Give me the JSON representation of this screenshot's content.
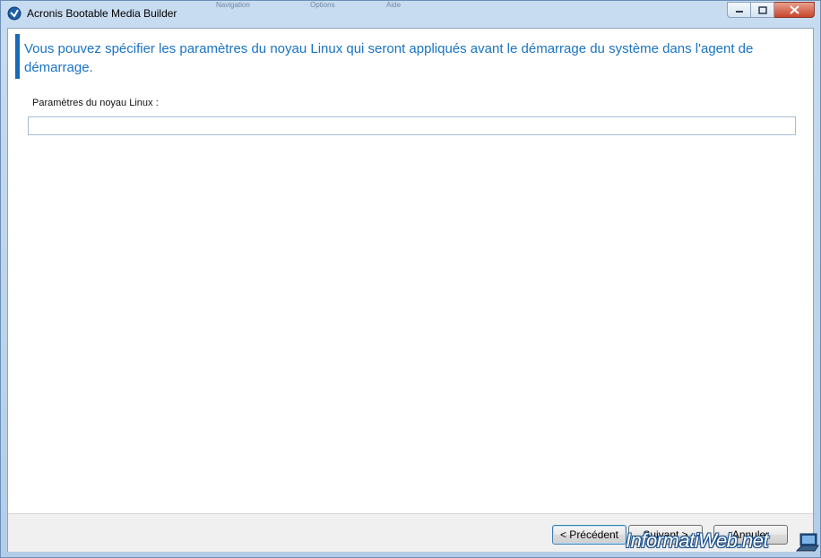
{
  "window": {
    "title": "Acronis Bootable Media Builder",
    "background_menus": [
      "Navigation",
      "Options",
      "Aide"
    ]
  },
  "page": {
    "heading": "Vous pouvez spécifier les paramètres du noyau Linux qui seront appliqués avant le démarrage du système dans l'agent de démarrage.",
    "kernel_params": {
      "label": "Paramètres du noyau Linux :",
      "value": "",
      "placeholder": ""
    }
  },
  "footer": {
    "prev_label": "< Précédent",
    "next_label": "Suivant >",
    "cancel_label": "Annuler"
  },
  "watermark": {
    "text": "InformatiWeb.net"
  },
  "colors": {
    "accent": "#1769b9",
    "heading_text": "#1a73c4"
  }
}
